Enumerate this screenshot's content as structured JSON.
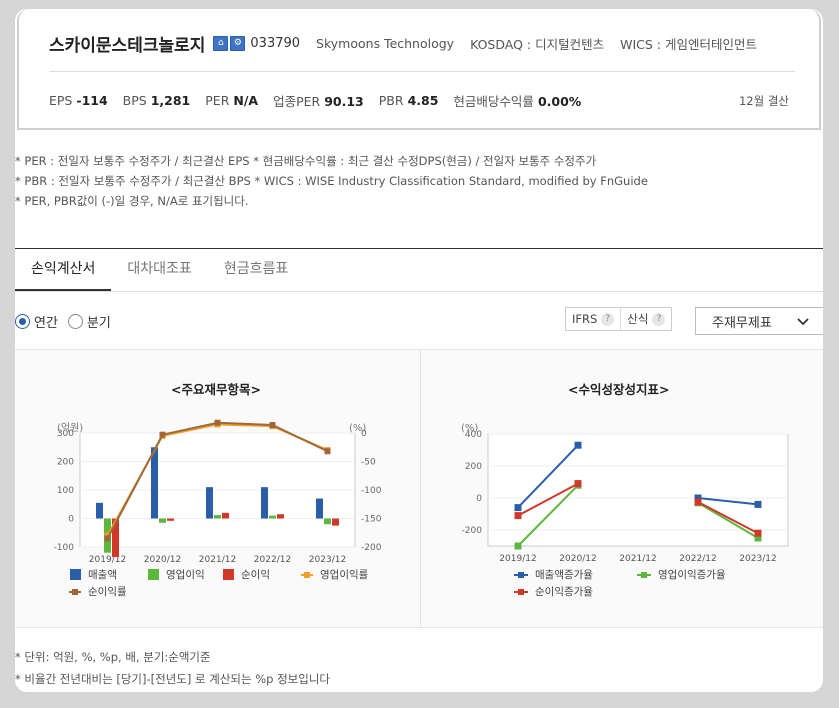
{
  "company": {
    "name": "스카이문스테크놀로지",
    "icon1": "⌂",
    "icon2": "⚙",
    "code": "033790",
    "english_name": "Skymoons Technology",
    "market": "KOSDAQ : 디지털컨텐츠",
    "wics": "WICS : 게임엔터테인먼트"
  },
  "stats": [
    {
      "label": "EPS",
      "value": "-114"
    },
    {
      "label": "BPS",
      "value": "1,281"
    },
    {
      "label": "PER",
      "value": "N/A"
    },
    {
      "label": "업종PER",
      "value": "90.13"
    },
    {
      "label": "PBR",
      "value": "4.85"
    },
    {
      "label": "현금배당수익률",
      "value": "0.00%"
    }
  ],
  "fiscal_month": "12월 결산",
  "notes": [
    "* PER : 전일자 보통주 수정주가 / 최근결산 EPS * 현금배당수익률 : 최근 결산 수정DPS(현금) / 전일자 보통주 수정주가",
    "* PBR : 전일자 보통주 수정주가 / 최근결산 BPS * WICS : WISE Industry Classification Standard, modified by FnGuide",
    "* PER, PBR값이 (-)일 경우, N/A로 표기됩니다."
  ],
  "tabs": [
    "손익계산서",
    "대차대조표",
    "현금흐름표"
  ],
  "period": {
    "annual": "연간",
    "quarter": "분기"
  },
  "ifrs": "IFRS",
  "calc": "산식",
  "qmark": "?",
  "select_value": "주재무제표",
  "panel1_title": "<주요재무항목>",
  "panel2_title": "<수익성장성지표>",
  "footer_notes": [
    "* 단위: 억원, %, %p, 배, 분기:순액기준",
    "* 비율간 전년대비는 [당기]-[전년도] 로 계산되는 %p 정보입니다"
  ],
  "colors": {
    "sales": "#2a5ea8",
    "op": "#5cb83c",
    "net": "#d0382a",
    "op_rate": "#f0a02a",
    "net_rate": "#a0683a"
  },
  "chart_data": [
    {
      "type": "bar",
      "title": "<주요재무항목>",
      "left_axis_label": "(억원)",
      "right_axis_label": "(%)",
      "categories": [
        "2019/12",
        "2020/12",
        "2021/12",
        "2022/12",
        "2023/12"
      ],
      "ylim": [
        -100,
        300
      ],
      "y2lim": [
        -200,
        0
      ],
      "yticks": [
        -100,
        0,
        100,
        200,
        300
      ],
      "y2ticks": [
        0,
        -50,
        -100,
        -150,
        -200
      ],
      "series": [
        {
          "name": "매출액",
          "kind": "bar",
          "values": [
            55,
            250,
            110,
            110,
            70
          ]
        },
        {
          "name": "영업이익",
          "kind": "bar",
          "values": [
            -120,
            -15,
            12,
            10,
            -20
          ]
        },
        {
          "name": "순이익",
          "kind": "bar",
          "values": [
            -135,
            -8,
            20,
            15,
            -25
          ]
        },
        {
          "name": "영업이익률",
          "kind": "line",
          "axis": "right",
          "values": [
            -180,
            -5,
            15,
            12,
            -30
          ]
        },
        {
          "name": "순이익률",
          "kind": "line",
          "axis": "right",
          "values": [
            -185,
            -3,
            18,
            14,
            -32
          ]
        }
      ]
    },
    {
      "type": "line",
      "title": "<수익성장성지표>",
      "ylabel": "(%)",
      "categories": [
        "2019/12",
        "2020/12",
        "2021/12",
        "2022/12",
        "2023/12"
      ],
      "ylim": [
        -300,
        400
      ],
      "yticks": [
        -200,
        0,
        200,
        400
      ],
      "series": [
        {
          "name": "매출액증가율",
          "values": [
            -60,
            330,
            null,
            0,
            -40
          ]
        },
        {
          "name": "영업이익증가율",
          "values": [
            -300,
            80,
            null,
            -30,
            -250
          ]
        },
        {
          "name": "순이익증가율",
          "values": [
            -110,
            90,
            null,
            -25,
            -220
          ]
        }
      ]
    }
  ]
}
